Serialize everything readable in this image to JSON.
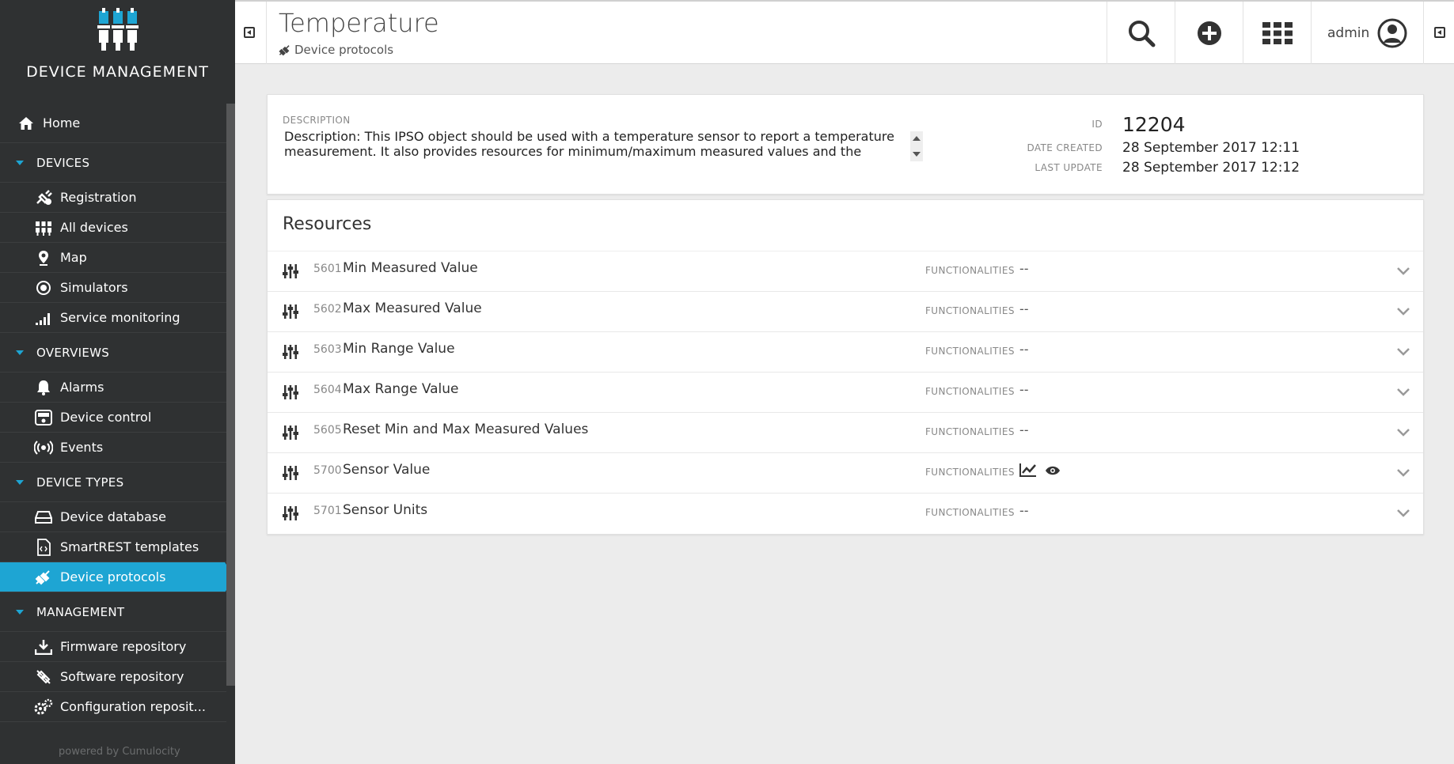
{
  "sidebar": {
    "brand": "DEVICE MANAGEMENT",
    "home": "Home",
    "groups": [
      {
        "title": "DEVICES",
        "items": [
          "Registration",
          "All devices",
          "Map",
          "Simulators",
          "Service monitoring"
        ]
      },
      {
        "title": "OVERVIEWS",
        "items": [
          "Alarms",
          "Device control",
          "Events"
        ]
      },
      {
        "title": "DEVICE TYPES",
        "items": [
          "Device database",
          "SmartREST templates",
          "Device protocols"
        ]
      },
      {
        "title": "MANAGEMENT",
        "items": [
          "Firmware repository",
          "Software repository",
          "Configuration reposit..."
        ]
      }
    ],
    "powered_by": "powered by Cumulocity",
    "active_item": "Device protocols"
  },
  "header": {
    "title": "Temperature",
    "breadcrumb": "Device protocols",
    "user": "admin"
  },
  "info": {
    "description_label": "DESCRIPTION",
    "description": "Description: This IPSO object should be used with a temperature sensor to report a temperature measurement.  It also provides resources for minimum/maximum measured values and the",
    "id_label": "ID",
    "id": "12204",
    "created_label": "DATE CREATED",
    "created": "28 September 2017 12:11",
    "updated_label": "LAST UPDATE",
    "updated": "28 September 2017 12:12"
  },
  "resources": {
    "title": "Resources",
    "func_label": "FUNCTIONALITIES",
    "rows": [
      {
        "id": "5601",
        "name": "Min Measured Value",
        "func": "--"
      },
      {
        "id": "5602",
        "name": "Max Measured Value",
        "func": "--"
      },
      {
        "id": "5603",
        "name": "Min Range Value",
        "func": "--"
      },
      {
        "id": "5604",
        "name": "Max Range Value",
        "func": "--"
      },
      {
        "id": "5605",
        "name": "Reset Min and Max Measured Values",
        "func": "--"
      },
      {
        "id": "5700",
        "name": "Sensor Value",
        "func": ""
      },
      {
        "id": "5701",
        "name": "Sensor Units",
        "func": "--"
      }
    ]
  },
  "colors": {
    "sidebar_bg": "#2f3132",
    "accent": "#1ea5d3"
  }
}
